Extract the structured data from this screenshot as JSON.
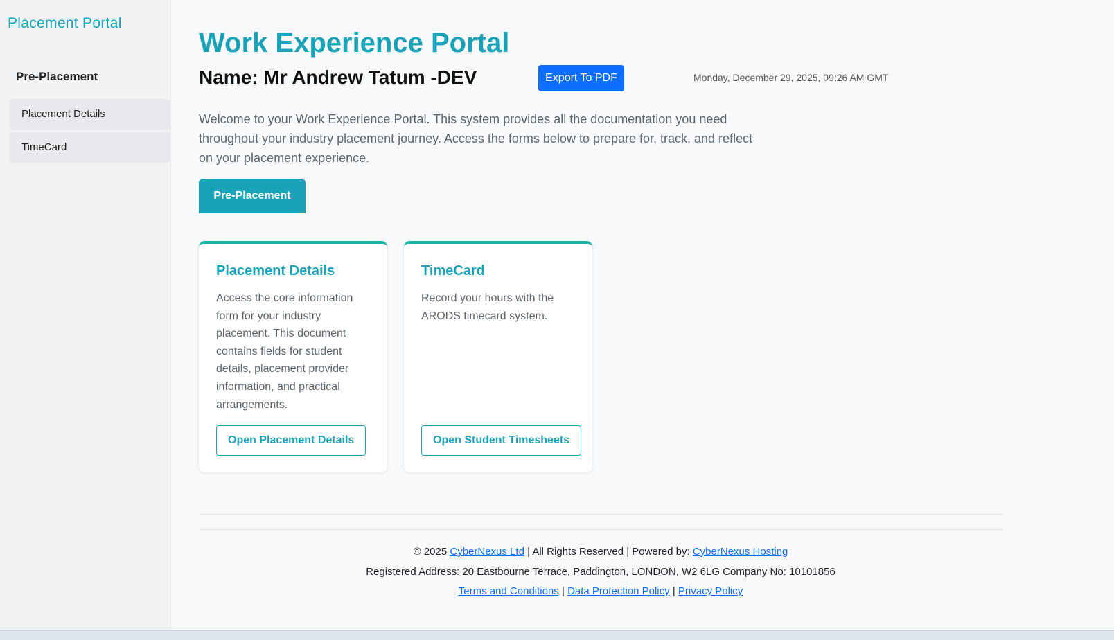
{
  "sidebar": {
    "brand": "Placement Portal",
    "heading": "Pre-Placement",
    "items": [
      {
        "label": "Placement Details"
      },
      {
        "label": "TimeCard"
      }
    ]
  },
  "header": {
    "title": "Work Experience Portal",
    "name": "Name: Mr Andrew Tatum -DEV",
    "export_label": "Export To PDF",
    "date": "Monday, December 29, 2025, 09:26 AM GMT"
  },
  "intro": "Welcome to your Work Experience Portal. This system provides all the documentation you need throughout your industry placement journey. Access the forms below to prepare for, track, and reflect on your placement experience.",
  "section_button": "Pre-Placement",
  "cards": [
    {
      "title": "Placement Details",
      "text": "Access the core information form for your industry placement. This document contains fields for student details, placement provider information, and practical arrangements.",
      "button": "Open Placement Details"
    },
    {
      "title": "TimeCard",
      "text": "Record your hours with the ARODS timecard system.",
      "button": "Open Student Timesheets"
    }
  ],
  "footer": {
    "copyright_prefix": "© 2025",
    "company_link": "CyberNexus Ltd",
    "rights_text": "| All Rights Reserved | Powered by:",
    "hosting_link": "CyberNexus Hosting",
    "address": "Registered Address: 20 Eastbourne Terrace, Paddington, LONDON, W2 6LG Company No: 10101856",
    "terms_link": "Terms and Conditions",
    "separator": "|",
    "data_protection_link": "Data Protection Policy",
    "privacy_link": "Privacy Policy"
  },
  "colors": {
    "accent": "#1aa3b8",
    "primary_button": "#0d6efd",
    "card_top_border": "#1fb5a5",
    "link": "#0d6efd"
  }
}
